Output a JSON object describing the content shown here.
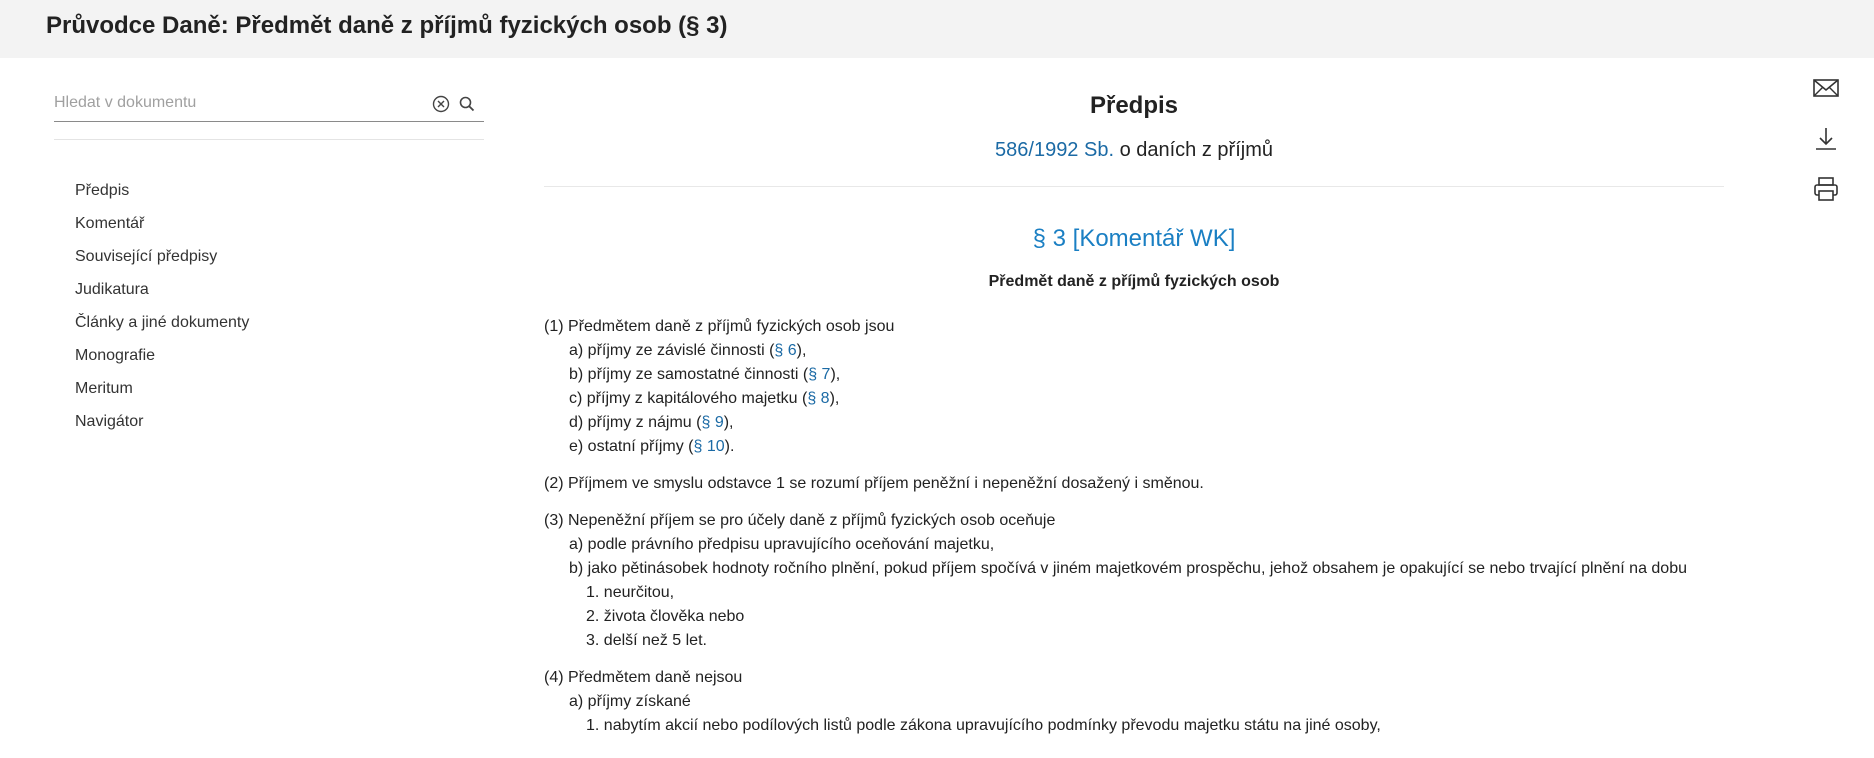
{
  "header": {
    "title": "Průvodce Daně: Předmět daně z příjmů fyzických osob (§ 3)"
  },
  "search": {
    "placeholder": "Hledat v dokumentu",
    "value": ""
  },
  "sidebar": {
    "items": [
      {
        "label": "Předpis"
      },
      {
        "label": "Komentář"
      },
      {
        "label": "Související předpisy"
      },
      {
        "label": "Judikatura"
      },
      {
        "label": "Články a jiné dokumenty"
      },
      {
        "label": "Monografie"
      },
      {
        "label": "Meritum"
      },
      {
        "label": "Navigátor"
      }
    ]
  },
  "toolbar": {
    "icons": [
      "mail-icon",
      "download-icon",
      "print-icon"
    ]
  },
  "doc": {
    "heading": "Předpis",
    "ref_link": "586/1992 Sb.",
    "ref_text": " o daních z příjmů",
    "section_title": "§ 3   [Komentář WK]",
    "section_subtitle": "Předmět daně z příjmů fyzických osob",
    "p1": {
      "intro": "(1) Předmětem daně z příjmů fyzických osob jsou",
      "items": [
        {
          "pre": "a) příjmy ze závislé činnosti (",
          "link": "§ 6",
          "post": "),"
        },
        {
          "pre": "b) příjmy ze samostatné činnosti (",
          "link": "§ 7",
          "post": "),"
        },
        {
          "pre": "c) příjmy z kapitálového majetku (",
          "link": "§ 8",
          "post": "),"
        },
        {
          "pre": "d) příjmy z nájmu (",
          "link": "§ 9",
          "post": "),"
        },
        {
          "pre": "e) ostatní příjmy (",
          "link": "§ 10",
          "post": ")."
        }
      ]
    },
    "p2": "(2) Příjmem ve smyslu odstavce 1 se rozumí příjem peněžní i nepeněžní dosažený i směnou.",
    "p3": {
      "intro": "(3) Nepeněžní příjem se pro účely daně z příjmů fyzických osob oceňuje",
      "a": "a) podle právního předpisu upravujícího oceňování majetku,",
      "b": "b) jako pětinásobek hodnoty ročního plnění, pokud příjem spočívá v jiném majetkovém prospěchu, jehož obsahem je opakující se nebo trvající plnění na dobu",
      "b_items": [
        "1. neurčitou,",
        "2. života člověka nebo",
        "3. delší než 5 let."
      ]
    },
    "p4": {
      "intro": "(4) Předmětem daně nejsou",
      "a": "a) příjmy získané",
      "a_items": [
        "1. nabytím akcií nebo podílových listů podle zákona upravujícího podmínky převodu majetku státu na jiné osoby,"
      ]
    }
  }
}
